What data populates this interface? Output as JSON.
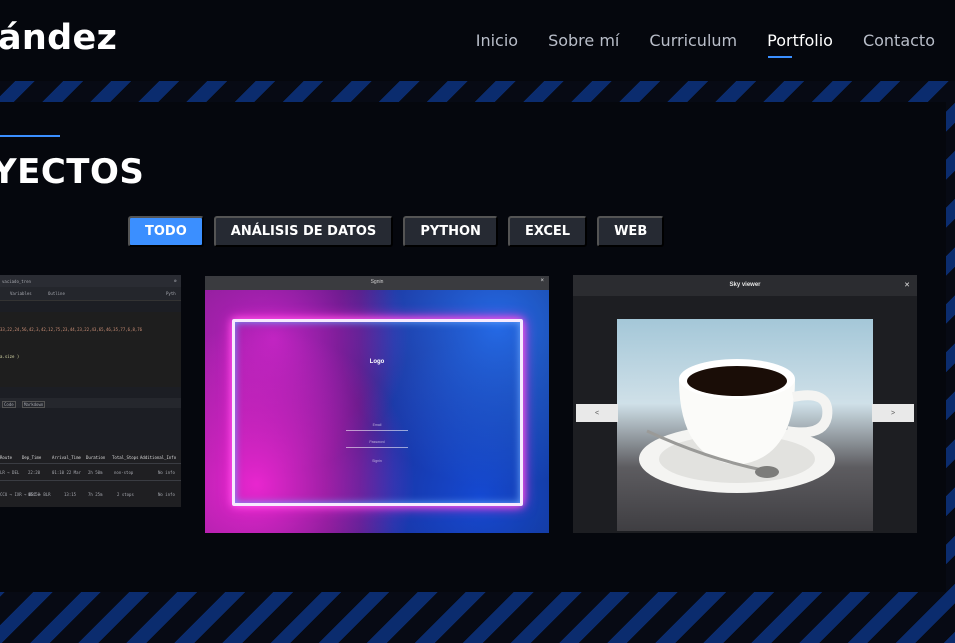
{
  "header": {
    "brand": "ández",
    "nav": [
      "Inicio",
      "Sobre mí",
      "Curriculum",
      "Portfolio",
      "Contacto"
    ],
    "active_nav": "Portfolio"
  },
  "section": {
    "title": "YECTOS",
    "filters": [
      "TODO",
      "ANÁLISIS DE DATOS",
      "PYTHON",
      "EXCEL",
      "WEB"
    ],
    "active_filter": "TODO"
  },
  "projects": {
    "code": {
      "file": "vaciado_tren",
      "tabs": [
        "Variables",
        "Outline"
      ],
      "lang": "Pyth",
      "series": "33,22,24,56,42,3,42,12,75,23,44,23,22,43,65,46,35,77,6,8,76",
      "code_line": "a.size )",
      "cell_tabs": [
        "Code",
        "Markdown"
      ],
      "table_headers": [
        "Route",
        "Dep_Time",
        "Arrival_Time",
        "Duration",
        "Total_Stops",
        "Additional_Info"
      ],
      "table_rows": [
        [
          "LR → DEL",
          "22:20",
          "01:10 22 Mar",
          "2h 50m",
          "non-stop",
          "No info"
        ],
        [
          "CCU → IXR → BBI → BLR",
          "05:50",
          "13:15",
          "7h 25m",
          "2 stops",
          "No info"
        ]
      ]
    },
    "login": {
      "window_title": "Sgnin",
      "logo": "Logo",
      "email": "Email",
      "password": "Password",
      "signin": "Signin"
    },
    "viewer": {
      "window_title": "Sky viewer",
      "prev": "<",
      "next": ">"
    }
  },
  "colors": {
    "accent": "#3b8fff",
    "panel": "#05070d",
    "stripe": "#0b2c6e"
  }
}
